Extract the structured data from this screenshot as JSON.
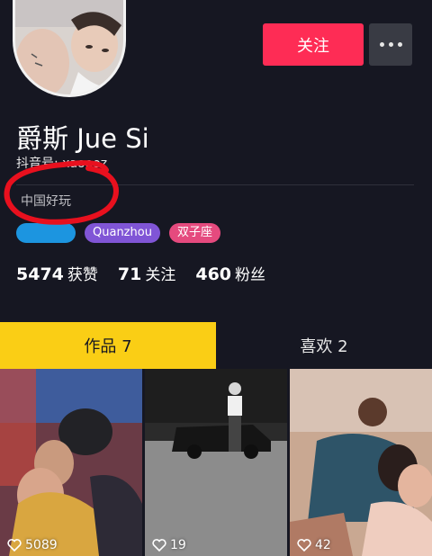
{
  "profile": {
    "name": "爵斯 Jue Si",
    "douyin_id": "抖音号: xaoooz",
    "bio": "中国好玩",
    "tags": [
      "",
      "Quanzhou",
      "双子座"
    ]
  },
  "actions": {
    "follow_label": "关注",
    "more_icon": "more-dots-icon"
  },
  "stats": [
    {
      "num": "5474",
      "label": "获赞"
    },
    {
      "num": "71",
      "label": "关注"
    },
    {
      "num": "460",
      "label": "粉丝"
    }
  ],
  "tabs": [
    {
      "label": "作品 7",
      "active": true
    },
    {
      "label": "喜欢 2",
      "active": false
    }
  ],
  "videos": [
    {
      "likes": "5089"
    },
    {
      "likes": "19"
    },
    {
      "likes": "42"
    }
  ],
  "colors": {
    "background": "#161722",
    "follow": "#fe2c55",
    "active_tab": "#face15",
    "annotation": "#e8101e"
  }
}
